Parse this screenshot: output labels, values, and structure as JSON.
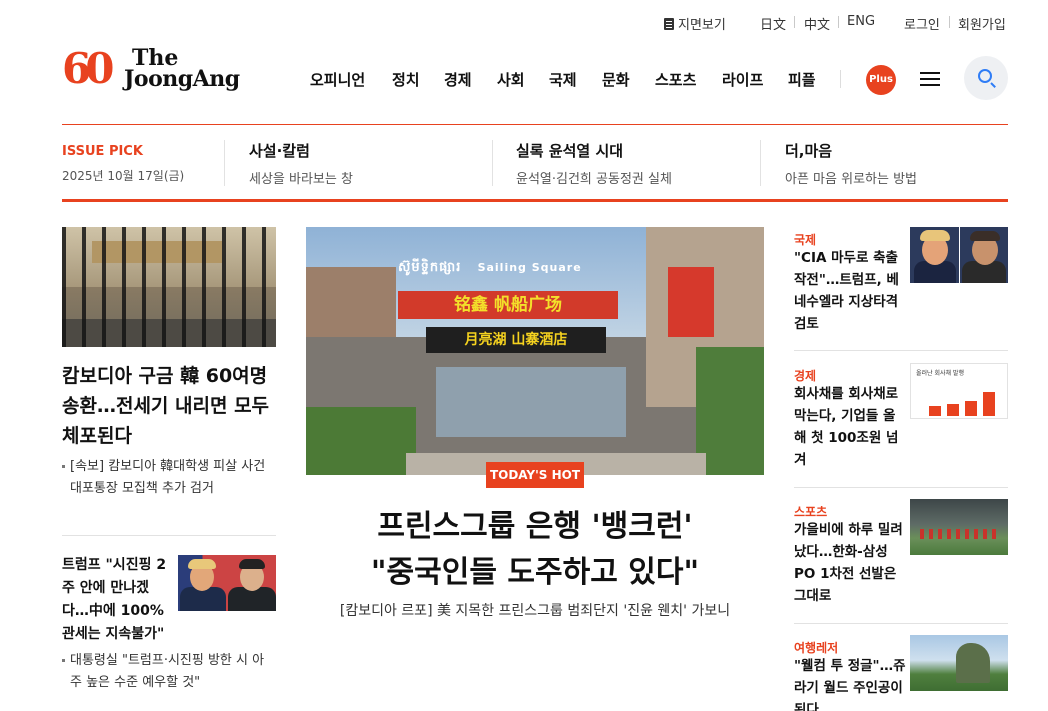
{
  "utility": {
    "print_edition": "지면보기",
    "languages": [
      "日文",
      "中文",
      "ENG"
    ],
    "login": "로그인",
    "signup": "회원가입"
  },
  "brand": {
    "logo_number": "60",
    "logo_the": "The",
    "logo_name": "JoongAng",
    "accent_color": "#e8421f"
  },
  "nav": {
    "items": [
      "오피니언",
      "정치",
      "경제",
      "사회",
      "국제",
      "문화",
      "스포츠",
      "라이프",
      "피플"
    ],
    "plus_label": "Plus",
    "menu_icon": "hamburger-icon",
    "search_icon": "search-icon"
  },
  "issue_pick": {
    "label": "ISSUE PICK",
    "date": "2025년 10월 17일(금)",
    "columns": [
      {
        "title": "사설·칼럼",
        "subtitle": "세상을 바라보는 창"
      },
      {
        "title": "실록 윤석열 시대",
        "subtitle": "윤석열·김건희 공동정권 실체"
      },
      {
        "title": "더,마음",
        "subtitle": "아픈 마음 위로하는 방법"
      }
    ]
  },
  "left": {
    "lead": {
      "title": "캄보디아 구금 韓 60여명 송환…전세기 내리면 모두 체포된다",
      "sub": "[속보] 캄보디아 韓대학생 피살 사건 대포통장 모집책 추가 검거"
    },
    "second": {
      "title": "트럼프 \"시진핑 2주 안에 만나겠다…中에 100% 관세는 지속불가\"",
      "sub": "대통령실 \"트럼프·시진핑 방한 시 아주 높은 수준 예우할 것\""
    }
  },
  "feature": {
    "photo_signs": {
      "khmer": "ស៊ូមីទ្ទិកផ្សារ",
      "english": "Sailing Square",
      "chinese_main": "铭鑫 帆船广场",
      "chinese_sub": "月亮湖 山寨酒店"
    },
    "badge": "TODAY'S HOT",
    "title_line1": "프린스그룹 은행 '뱅크런'",
    "title_line2": "\"중국인들 도주하고 있다\"",
    "subtitle": "[캄보디아 르포] 美 지목한 프린스그룹 범죄단지 '진윤 웬치' 가보니"
  },
  "right": {
    "items": [
      {
        "category": "국제",
        "title": "\"CIA 마두로 축출 작전\"…트럼프, 베네수엘라 지상타격 검토"
      },
      {
        "category": "경제",
        "title": "회사채를 회사채로 막는다, 기업들 올해 첫 100조원 넘겨",
        "chart_title": "올러난 회사채 발행"
      },
      {
        "category": "스포츠",
        "title": "가을비에 하루 밀려났다…한화-삼성 PO 1차전 선발은 그대로"
      },
      {
        "category": "여행레저",
        "title": "\"웰컴 투 정글\"…쥬라기 월드 주인공이 된다"
      }
    ]
  }
}
